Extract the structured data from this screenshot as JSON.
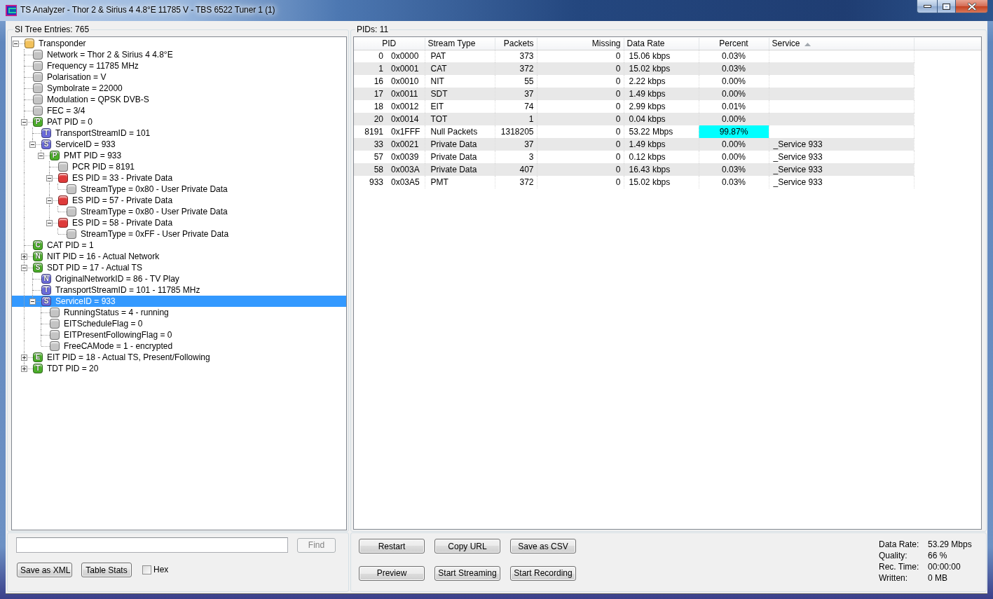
{
  "window": {
    "title": "TS Analyzer - Thor 2 & Sirius 4 4.8°E 11785 V - TBS 6522 Tuner 1 (1)"
  },
  "si_tree": {
    "heading": "SI Tree Entries: 765",
    "nodes": [
      {
        "label": "Transponder",
        "color": "#f2c15a",
        "expanded": true,
        "selected": false,
        "children": [
          {
            "label": "Network = Thor 2 & Sirius 4 4.8°E",
            "color": "#c4c4c4",
            "selected": false
          },
          {
            "label": "Frequency = 11785 MHz",
            "color": "#c4c4c4",
            "selected": false
          },
          {
            "label": "Polarisation = V",
            "color": "#c4c4c4",
            "selected": false
          },
          {
            "label": "Symbolrate = 22000",
            "color": "#c4c4c4",
            "selected": false
          },
          {
            "label": "Modulation = QPSK DVB-S",
            "color": "#c4c4c4",
            "selected": false
          },
          {
            "label": "FEC = 3/4",
            "color": "#c4c4c4",
            "selected": false
          },
          {
            "label": "PAT PID = 0",
            "color": "#4caf2a",
            "badge": "P",
            "expanded": true,
            "selected": false,
            "children": [
              {
                "label": "TransportStreamID = 101",
                "color": "#6b6bdc",
                "badge": "T",
                "selected": false
              },
              {
                "label": "ServiceID = 933",
                "color": "#6b6bdc",
                "badge": "S",
                "expanded": true,
                "selected": false,
                "children": [
                  {
                    "label": "PMT PID = 933",
                    "color": "#4caf2a",
                    "badge": "P",
                    "expanded": true,
                    "selected": false,
                    "children": [
                      {
                        "label": "PCR PID = 8191",
                        "color": "#c4c4c4",
                        "selected": false
                      },
                      {
                        "label": "ES PID = 33 - Private Data",
                        "color": "#de3a3a",
                        "expanded": true,
                        "selected": false,
                        "children": [
                          {
                            "label": "StreamType = 0x80 - User Private Data",
                            "color": "#c4c4c4",
                            "selected": false
                          }
                        ]
                      },
                      {
                        "label": "ES PID = 57 - Private Data",
                        "color": "#de3a3a",
                        "expanded": true,
                        "selected": false,
                        "children": [
                          {
                            "label": "StreamType = 0x80 - User Private Data",
                            "color": "#c4c4c4",
                            "selected": false
                          }
                        ]
                      },
                      {
                        "label": "ES PID = 58 - Private Data",
                        "color": "#de3a3a",
                        "expanded": true,
                        "selected": false,
                        "children": [
                          {
                            "label": "StreamType = 0xFF - User Private Data",
                            "color": "#c4c4c4",
                            "selected": false
                          }
                        ]
                      }
                    ]
                  }
                ]
              }
            ]
          },
          {
            "label": "CAT PID = 1",
            "color": "#4caf2a",
            "badge": "C",
            "selected": false
          },
          {
            "label": "NIT PID = 16 - Actual Network",
            "color": "#4caf2a",
            "badge": "N",
            "expanded": false,
            "selected": false
          },
          {
            "label": "SDT PID = 17 - Actual TS",
            "color": "#4caf2a",
            "badge": "S",
            "expanded": true,
            "selected": false,
            "children": [
              {
                "label": "OriginalNetworkID = 86 - TV Play",
                "color": "#6b6bdc",
                "badge": "N",
                "selected": false
              },
              {
                "label": "TransportStreamID = 101 - 11785 MHz",
                "color": "#6b6bdc",
                "badge": "T",
                "selected": false
              },
              {
                "label": "ServiceID = 933",
                "color": "#6b6bdc",
                "badge": "S",
                "expanded": true,
                "selected": true,
                "children": [
                  {
                    "label": "RunningStatus = 4 - running",
                    "color": "#c4c4c4",
                    "selected": false
                  },
                  {
                    "label": "EITScheduleFlag = 0",
                    "color": "#c4c4c4",
                    "selected": false
                  },
                  {
                    "label": "EITPresentFollowingFlag = 0",
                    "color": "#c4c4c4",
                    "selected": false
                  },
                  {
                    "label": "FreeCAMode = 1 - encrypted",
                    "color": "#c4c4c4",
                    "selected": false
                  }
                ]
              }
            ]
          },
          {
            "label": "EIT PID = 18 - Actual TS, Present/Following",
            "color": "#4caf2a",
            "badge": "E",
            "expanded": false,
            "selected": false
          },
          {
            "label": "TDT PID = 20",
            "color": "#4caf2a",
            "badge": "T",
            "expanded": false,
            "selected": false
          }
        ]
      }
    ]
  },
  "find_button": {
    "label": "Find",
    "disabled": true
  },
  "tree_buttons": [
    {
      "label": "Save as XML"
    },
    {
      "label": "Table Stats"
    }
  ],
  "hex_checkbox": {
    "label": "Hex",
    "checked": false
  },
  "pid_table": {
    "heading": "PIDs: 11",
    "columns": [
      {
        "label": "PID",
        "sorted": false
      },
      {
        "label": "Stream Type",
        "sorted": false
      },
      {
        "label": "Packets",
        "sorted": false
      },
      {
        "label": "Missing",
        "sorted": false
      },
      {
        "label": "Data Rate",
        "sorted": false
      },
      {
        "label": "Percent",
        "sorted": false
      },
      {
        "label": "Service",
        "sorted": true
      }
    ],
    "rows": [
      {
        "pid": "0",
        "pid_hex": "0x0000",
        "stream_type": "PAT",
        "packets": "373",
        "missing": "0",
        "data_rate": "15.06 kbps",
        "percent": "0.03%",
        "highlighted": false
      },
      {
        "pid": "1",
        "pid_hex": "0x0001",
        "stream_type": "CAT",
        "packets": "372",
        "missing": "0",
        "data_rate": "15.02 kbps",
        "percent": "0.03%",
        "highlighted": false
      },
      {
        "pid": "16",
        "pid_hex": "0x0010",
        "stream_type": "NIT",
        "packets": "55",
        "missing": "0",
        "data_rate": "2.22 kbps",
        "percent": "0.00%",
        "highlighted": false
      },
      {
        "pid": "17",
        "pid_hex": "0x0011",
        "stream_type": "SDT",
        "packets": "37",
        "missing": "0",
        "data_rate": "1.49 kbps",
        "percent": "0.00%",
        "highlighted": false
      },
      {
        "pid": "18",
        "pid_hex": "0x0012",
        "stream_type": "EIT",
        "packets": "74",
        "missing": "0",
        "data_rate": "2.99 kbps",
        "percent": "0.01%",
        "highlighted": false
      },
      {
        "pid": "20",
        "pid_hex": "0x0014",
        "stream_type": "TOT",
        "packets": "1",
        "missing": "0",
        "data_rate": "0.04 kbps",
        "percent": "0.00%",
        "highlighted": false
      },
      {
        "pid": "8191",
        "pid_hex": "0x1FFF",
        "stream_type": "Null Packets",
        "packets": "1318205",
        "missing": "0",
        "data_rate": "53.22 Mbps",
        "percent": "99.87%",
        "highlighted": true
      },
      {
        "pid": "33",
        "pid_hex": "0x0021",
        "stream_type": "Private Data",
        "packets": "37",
        "missing": "0",
        "data_rate": "1.49 kbps",
        "percent": "0.00%",
        "service": "_Service 933",
        "highlighted": false
      },
      {
        "pid": "57",
        "pid_hex": "0x0039",
        "stream_type": "Private Data",
        "packets": "3",
        "missing": "0",
        "data_rate": "0.12 kbps",
        "percent": "0.00%",
        "service": "_Service 933",
        "highlighted": false
      },
      {
        "pid": "58",
        "pid_hex": "0x003A",
        "stream_type": "Private Data",
        "packets": "407",
        "missing": "0",
        "data_rate": "16.43 kbps",
        "percent": "0.03%",
        "service": "_Service 933",
        "highlighted": false
      },
      {
        "pid": "933",
        "pid_hex": "0x03A5",
        "stream_type": "PMT",
        "packets": "372",
        "missing": "0",
        "data_rate": "15.02 kbps",
        "percent": "0.03%",
        "service": "_Service 933",
        "highlighted": false
      }
    ]
  },
  "action_buttons": [
    {
      "label": "Restart"
    },
    {
      "label": "Copy URL"
    },
    {
      "label": "Save as CSV"
    },
    {
      "label": "Preview"
    },
    {
      "label": "Start Streaming"
    },
    {
      "label": "Start Recording"
    }
  ],
  "status": [
    {
      "label": "Data Rate:",
      "value": "53.29 Mbps"
    },
    {
      "label": "Quality:",
      "value": "66 %"
    },
    {
      "label": "Rec. Time:",
      "value": "00:00:00"
    },
    {
      "label": "Written:",
      "value": "0 MB"
    }
  ]
}
